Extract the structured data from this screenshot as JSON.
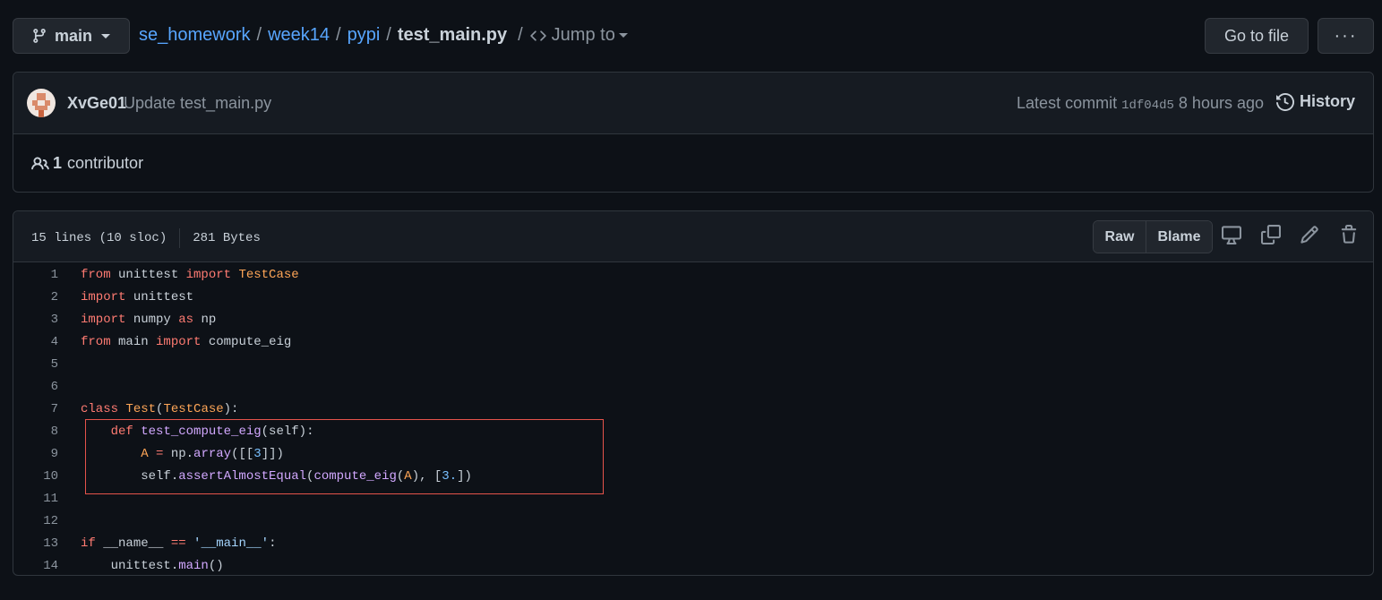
{
  "branch": {
    "label": "main"
  },
  "breadcrumb": {
    "repo": "se_homework",
    "path": [
      "week14",
      "pypi"
    ],
    "file": "test_main.py",
    "jump_label": "Jump to"
  },
  "toolbar": {
    "goto_label": "Go to file",
    "more_label": "···"
  },
  "commit": {
    "author": "XvGe01",
    "message": "Update test_main.py",
    "latest_label": "Latest commit",
    "sha": "1df04d5",
    "time": "8 hours ago",
    "history_label": "History"
  },
  "contributors": {
    "count": "1",
    "label": "contributor"
  },
  "file": {
    "lines_info": "15 lines (10 sloc)",
    "size": "281 Bytes",
    "raw_label": "Raw",
    "blame_label": "Blame"
  },
  "code_lines": [
    "from unittest import TestCase",
    "import unittest",
    "import numpy as np",
    "from main import compute_eig",
    "",
    "",
    "class Test(TestCase):",
    "    def test_compute_eig(self):",
    "        A = np.array([[3]])",
    "        self.assertAlmostEqual(compute_eig(A), [3.])",
    "",
    "",
    "if __name__ == '__main__':",
    "    unittest.main()"
  ],
  "icons": {
    "branch": "git-branch-icon",
    "code": "code-icon",
    "history": "history-icon",
    "people": "people-icon",
    "display": "desktop-icon",
    "copy": "copy-icon",
    "edit": "pencil-icon",
    "delete": "trash-icon"
  },
  "colors": {
    "background": "#0d1117",
    "link": "#58a6ff",
    "keyword": "#ff7b72",
    "highlight_box": "#e5534b"
  }
}
